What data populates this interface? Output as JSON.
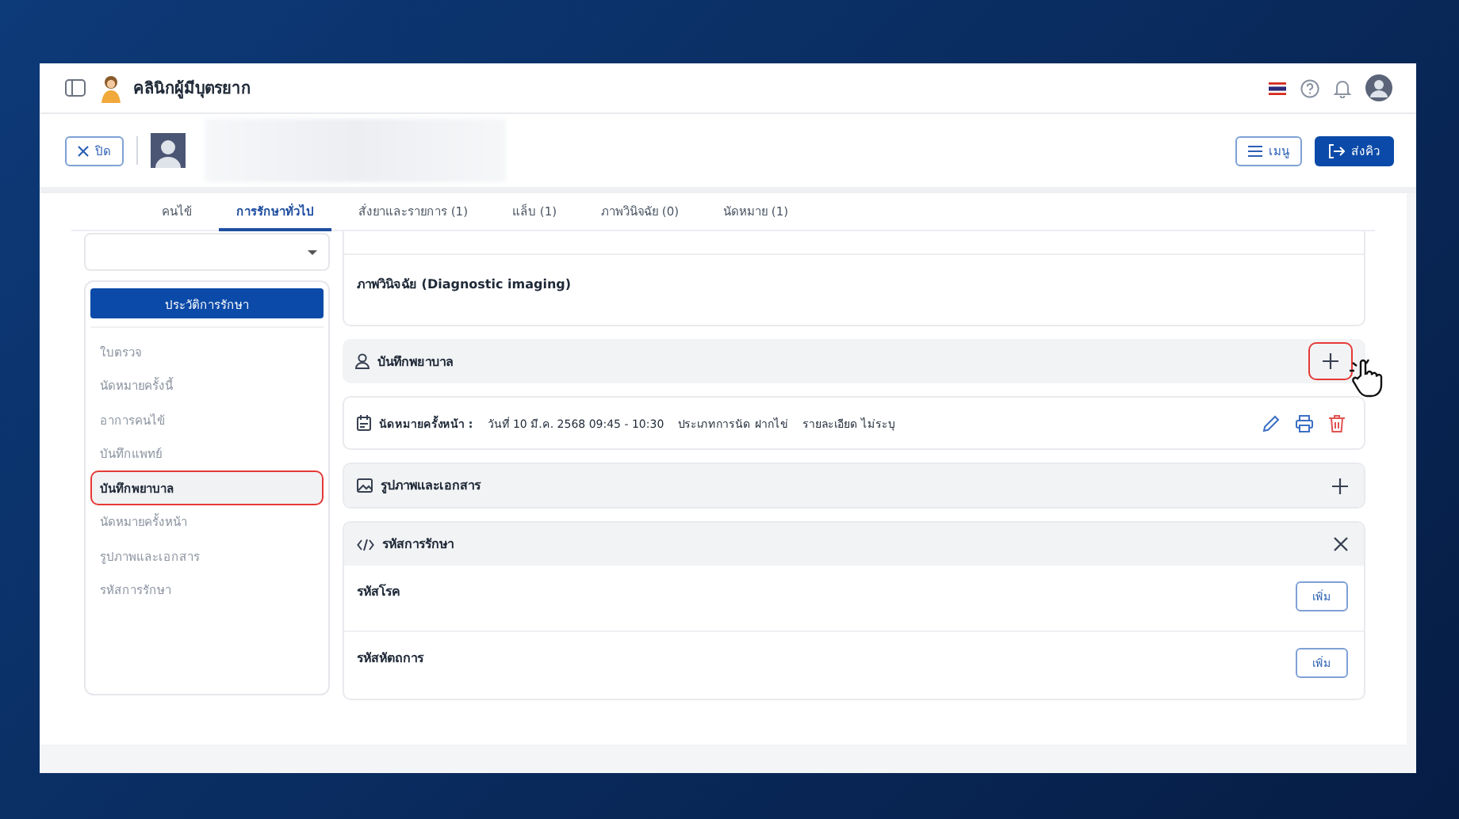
{
  "app": {
    "title": "คลินิกผู้มีบุตรยาก"
  },
  "header": {
    "close_button": "ปิด",
    "menu_button": "เมนู",
    "queue_button": "ส่งคิว"
  },
  "tabs": [
    {
      "label": "คนไข้",
      "selected": false
    },
    {
      "label": "การรักษาทั่วไป",
      "selected": true
    },
    {
      "label": "สั่งยาและรายการ (1)",
      "selected": false
    },
    {
      "label": "แล็บ (1)",
      "selected": false
    },
    {
      "label": "ภาพวินิจฉัย (0)",
      "selected": false
    },
    {
      "label": "นัดหมาย (1)",
      "selected": false
    }
  ],
  "sidebar": {
    "history_button": "ประวัติการรักษา",
    "items": [
      {
        "label": "ใบตรวจ",
        "selected": false,
        "highlighted": false
      },
      {
        "label": "นัดหมายครั้งนี้",
        "selected": false,
        "highlighted": false
      },
      {
        "label": "อาการคนไข้",
        "selected": false,
        "highlighted": false
      },
      {
        "label": "บันทึกแพทย์",
        "selected": false,
        "highlighted": false
      },
      {
        "label": "บันทึกพยาบาล",
        "selected": true,
        "highlighted": true
      },
      {
        "label": "นัดหมายครั้งหน้า",
        "selected": false,
        "highlighted": false
      },
      {
        "label": "รูปภาพและเอกสาร",
        "selected": false,
        "highlighted": false
      },
      {
        "label": "รหัสการรักษา",
        "selected": false,
        "highlighted": false
      }
    ]
  },
  "imaging": {
    "title": "ภาพวินิจฉัย (Diagnostic imaging)"
  },
  "nursing_notes": {
    "title": "บันทึกพยาบาล",
    "add_highlighted": true,
    "entries": [
      {
        "label": "นัดหมายครั้งหน้า :",
        "date": "วันที่ 10 มี.ค. 2568 09:45 - 10:30",
        "type": "ประเภทการนัด ฝากไข่",
        "detail": "รายละเอียด ไม่ระบุ"
      }
    ]
  },
  "panels": [
    {
      "kind": "documents",
      "title": "รูปภาพและเอกสาร",
      "expanded": false
    },
    {
      "kind": "codes",
      "title": "รหัสการรักษา",
      "expanded": true,
      "rows": [
        {
          "label": "รหัสโรค",
          "button": "เพิ่ม"
        },
        {
          "label": "รหัสหัตถการ",
          "button": "เพิ่ม"
        }
      ]
    }
  ]
}
